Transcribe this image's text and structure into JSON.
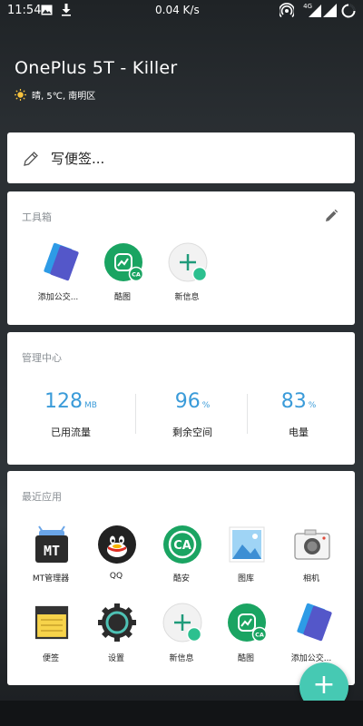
{
  "status_bar": {
    "time": "11:54",
    "net_speed": "0.04 K/s",
    "signal_type": "4G",
    "icons": [
      "image-notification-icon",
      "download-icon",
      "hotspot-icon",
      "signal-4g-icon",
      "signal-icon",
      "battery-icon",
      "loading-icon"
    ]
  },
  "header": {
    "title": "OnePlus 5T - Killer",
    "weather": "晴, 5℃, 南明区",
    "weather_icon": "sun-icon"
  },
  "memo": {
    "placeholder": "写便签...",
    "icon": "pencil-icon"
  },
  "toolbox": {
    "title": "工具箱",
    "items": [
      {
        "label": "添加公交...",
        "icon": "transit-card-icon"
      },
      {
        "label": "酷图",
        "icon": "kutu-icon"
      },
      {
        "label": "新信息",
        "icon": "new-message-icon"
      }
    ]
  },
  "management": {
    "title": "管理中心",
    "stats": [
      {
        "value": "128",
        "unit": "MB",
        "label": "已用流量"
      },
      {
        "value": "96",
        "unit": "%",
        "label": "剩余空间"
      },
      {
        "value": "83",
        "unit": "%",
        "label": "电量"
      }
    ]
  },
  "recent_apps": {
    "title": "最近应用",
    "row1": [
      {
        "label": "MT管理器",
        "icon": "mt-manager-icon"
      },
      {
        "label": "QQ",
        "icon": "qq-icon"
      },
      {
        "label": "酷安",
        "icon": "coolapk-icon"
      },
      {
        "label": "图库",
        "icon": "gallery-icon"
      },
      {
        "label": "相机",
        "icon": "camera-icon"
      }
    ],
    "row2": [
      {
        "label": "便签",
        "icon": "notes-icon"
      },
      {
        "label": "设置",
        "icon": "settings-icon"
      },
      {
        "label": "新信息",
        "icon": "new-message-icon"
      },
      {
        "label": "酷图",
        "icon": "kutu-icon"
      },
      {
        "label": "添加公交...",
        "icon": "transit-card-icon"
      }
    ]
  },
  "fab": {
    "label": "+",
    "icon": "add-icon"
  },
  "colors": {
    "accent": "#3a9bd9",
    "fab": "#46c9b3",
    "green_icon": "#1aa462"
  }
}
